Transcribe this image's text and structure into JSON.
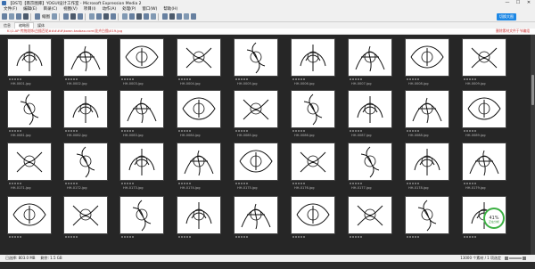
{
  "window": {
    "title": "【DST】【南京图库】YOGUI设计工作室 - Microsoft Expression Media 2",
    "minimize": "—",
    "maximize": "☐",
    "close": "✕"
  },
  "menu": [
    "文件(F)",
    "编辑(E)",
    "目录(C)",
    "视图(V)",
    "项目(I)",
    "动作(A)",
    "处理(P)",
    "窗口(W)",
    "帮助(H)"
  ],
  "toolbar": {
    "view_label": "缩图",
    "signin_label": "切换大图"
  },
  "tabs": [
    "信息",
    "缩略图",
    "媒体"
  ],
  "path": {
    "left": "K:\\1.AP 传统纹饰\\白描百花#####\\kown.taobao.com\\花卉白描\\019.jpg",
    "right": "删除素材文件于节编组"
  },
  "thumbnails": {
    "row1": [
      "HH-0001.jpg",
      "HH-0002.jpg",
      "HH-0003.jpg",
      "HH-0004.jpg",
      "HH-0005.jpg",
      "HH-0006.jpg",
      "HH-0007.jpg",
      "HH-0008.jpg",
      "HH-0009.jpg"
    ],
    "row2": [
      "HH-0081.jpg",
      "HH-0082.jpg",
      "HH-0083.jpg",
      "HH-0084.jpg",
      "HH-0085.jpg",
      "HH-0086.jpg",
      "HH-0087.jpg",
      "HH-0088.jpg",
      "HH-0089.jpg"
    ],
    "row3": [
      "HH-0171.jpg",
      "HH-0172.jpg",
      "HH-0173.jpg",
      "HH-0174.jpg",
      "HH-0175.jpg",
      "HH-0176.jpg",
      "HH-0177.jpg",
      "HH-0178.jpg",
      "HH-0179.jpg"
    ],
    "row4": [
      "",
      "",
      "",
      "",
      "",
      "",
      "",
      "",
      ""
    ]
  },
  "status": {
    "left": "已选择: 803.0 MB",
    "middle": "剩余: 1.5 GB",
    "right": "13000 个素材 / 1 项选定"
  },
  "progress": {
    "value": "41%",
    "sub": "正在分析"
  },
  "colors": {
    "background": "#262626",
    "accent": "#1e88e5",
    "path_text": "#cc3333",
    "progress_ring": "#3cb043"
  }
}
